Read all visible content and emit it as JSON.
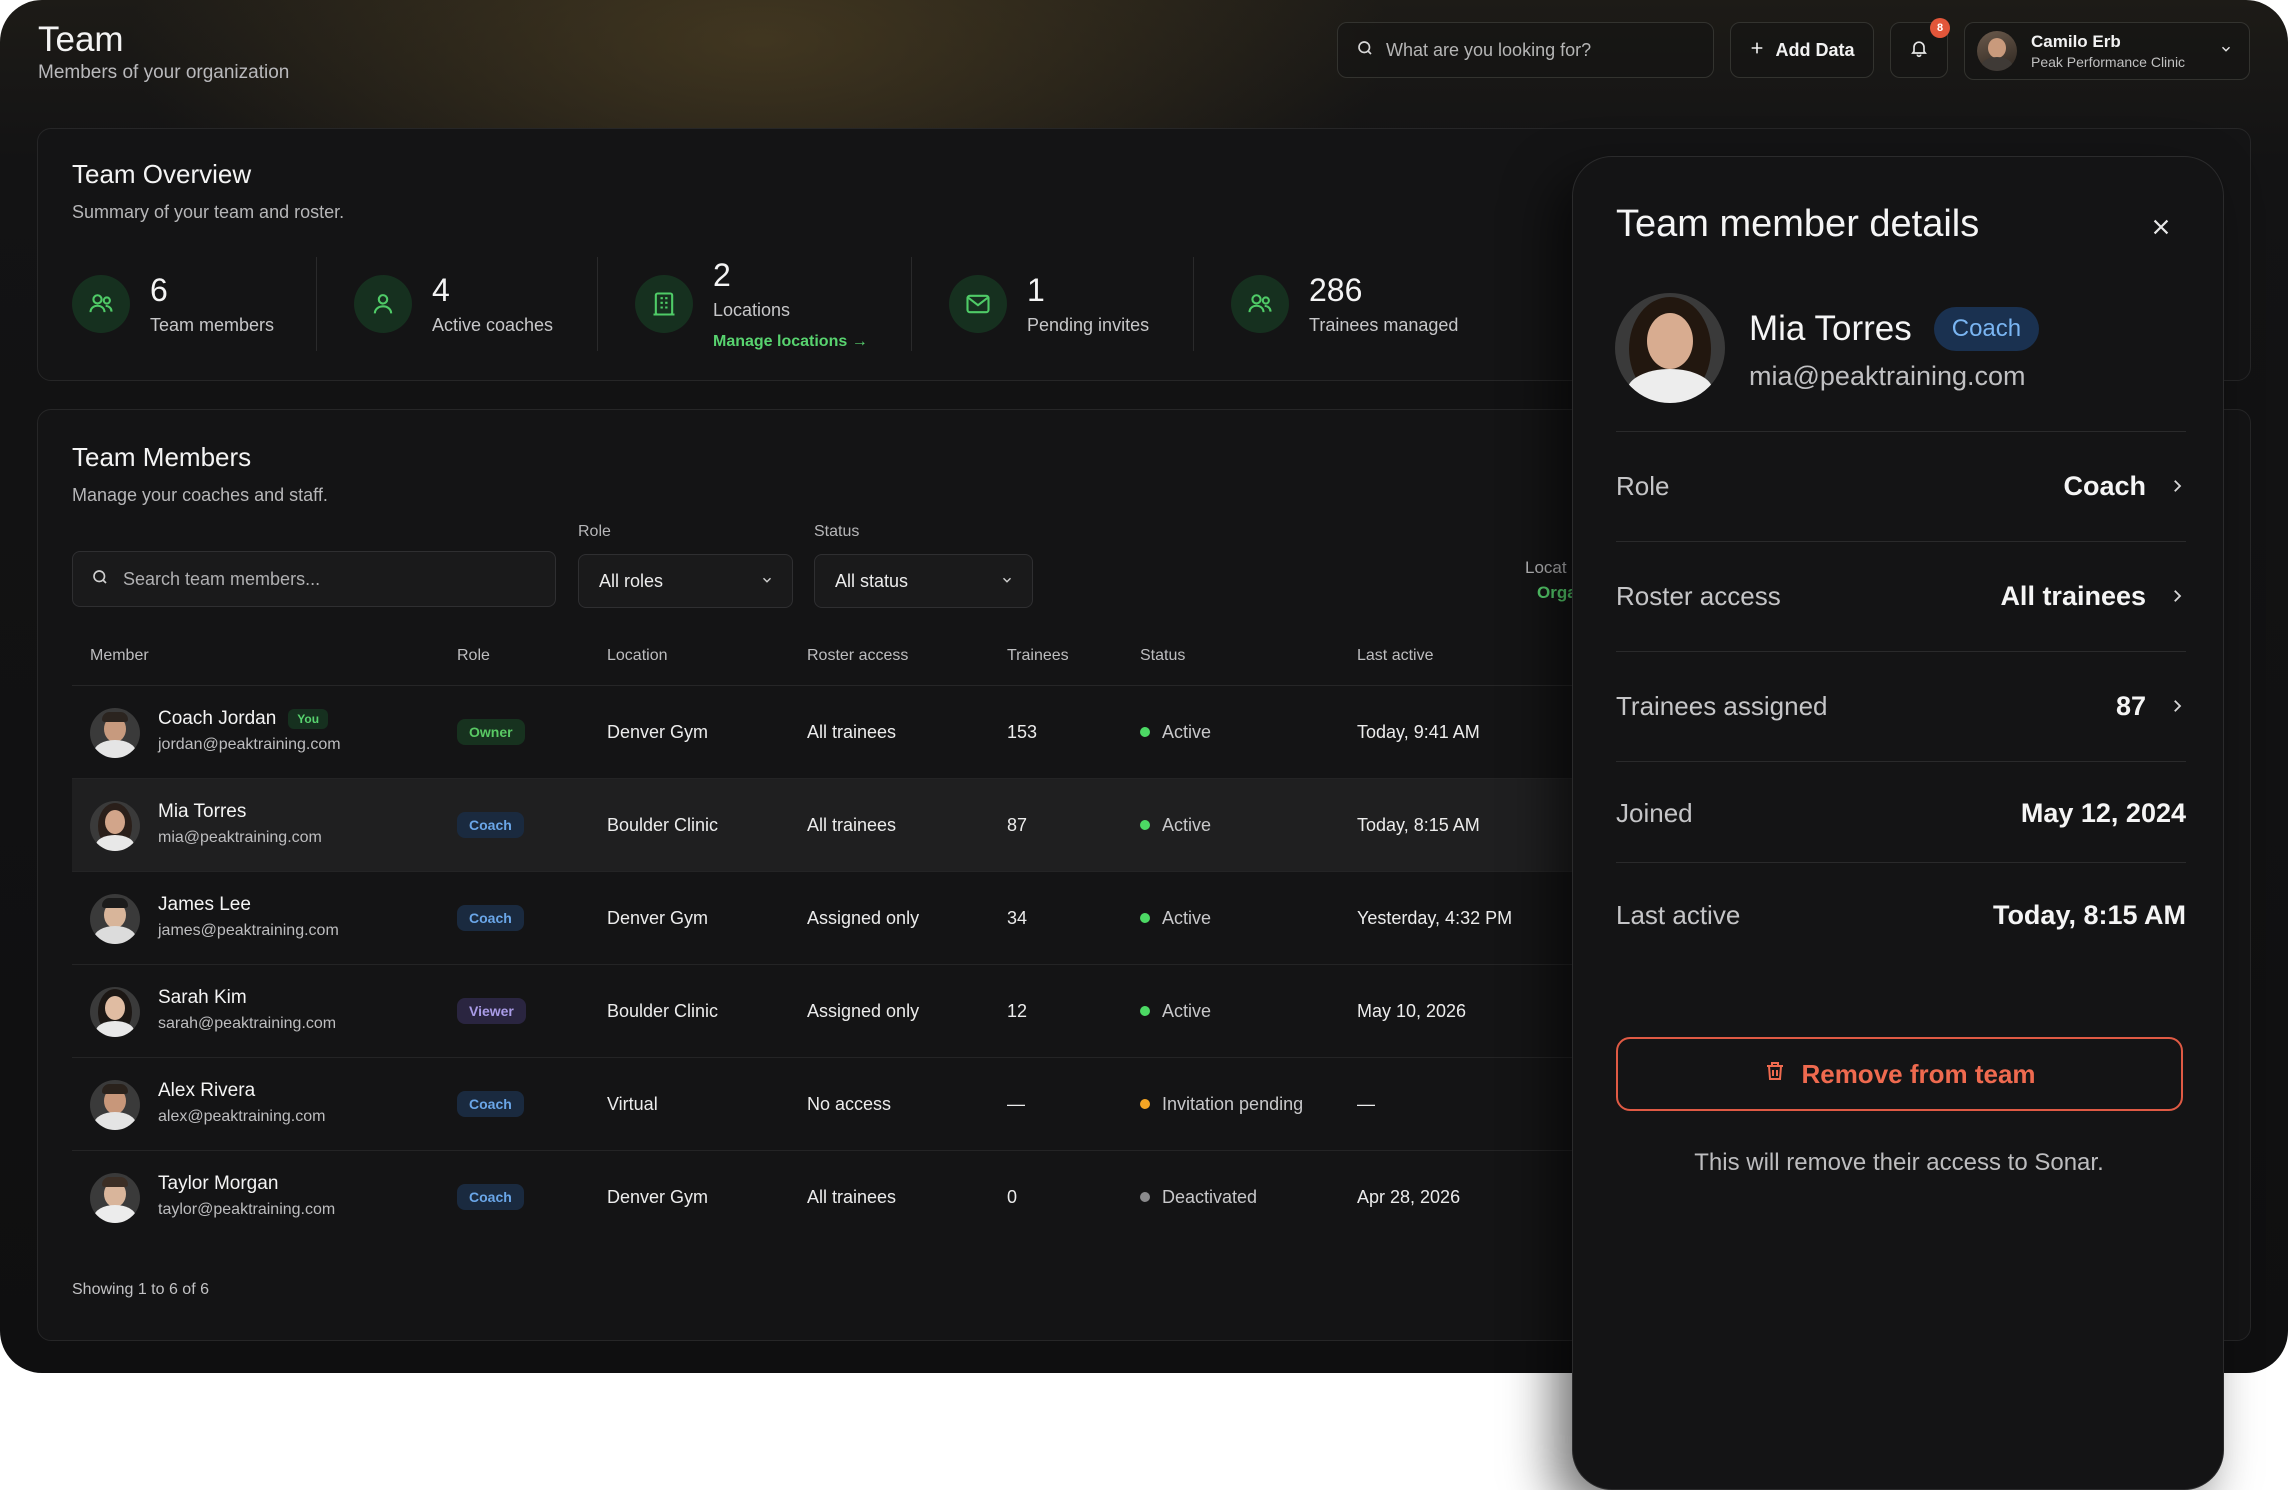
{
  "header": {
    "title": "Team",
    "subtitle": "Members of your organization",
    "search_placeholder": "What are you looking for?",
    "add_label": "Add Data",
    "notification_count": "8",
    "user": {
      "name": "Camilo Erb",
      "org": "Peak Performance Clinic"
    }
  },
  "overview": {
    "title": "Team Overview",
    "subtitle": "Summary of your team and roster.",
    "stats": [
      {
        "value": "6",
        "label": "Team members",
        "icon": "users-icon"
      },
      {
        "value": "4",
        "label": "Active coaches",
        "icon": "user-icon"
      },
      {
        "value": "2",
        "label": "Locations",
        "icon": "building-icon",
        "link": "Manage locations →"
      },
      {
        "value": "1",
        "label": "Pending invites",
        "icon": "mail-icon"
      },
      {
        "value": "286",
        "label": "Trainees managed",
        "icon": "users-icon"
      }
    ]
  },
  "members": {
    "title": "Team Members",
    "subtitle": "Manage your coaches and staff.",
    "search_placeholder": "Search team members...",
    "role_filter": {
      "label": "Role",
      "value": "All roles"
    },
    "status_filter": {
      "label": "Status",
      "value": "All status"
    },
    "location_filter_peek": {
      "label": "Locat",
      "value": "Orga"
    },
    "columns": [
      "Member",
      "Role",
      "Location",
      "Roster access",
      "Trainees",
      "Status",
      "Last active"
    ],
    "rows": [
      {
        "name": "Coach Jordan",
        "you": "You",
        "email": "jordan@peaktraining.com",
        "role": "Owner",
        "location": "Denver Gym",
        "access": "All trainees",
        "trainees": "153",
        "status": "Active",
        "last_active": "Today, 9:41 AM"
      },
      {
        "name": "Mia Torres",
        "you": "",
        "email": "mia@peaktraining.com",
        "role": "Coach",
        "location": "Boulder Clinic",
        "access": "All trainees",
        "trainees": "87",
        "status": "Active",
        "last_active": "Today, 8:15 AM"
      },
      {
        "name": "James Lee",
        "you": "",
        "email": "james@peaktraining.com",
        "role": "Coach",
        "location": "Denver Gym",
        "access": "Assigned only",
        "trainees": "34",
        "status": "Active",
        "last_active": "Yesterday, 4:32 PM"
      },
      {
        "name": "Sarah Kim",
        "you": "",
        "email": "sarah@peaktraining.com",
        "role": "Viewer",
        "location": "Boulder Clinic",
        "access": "Assigned only",
        "trainees": "12",
        "status": "Active",
        "last_active": "May 10, 2026"
      },
      {
        "name": "Alex Rivera",
        "you": "",
        "email": "alex@peaktraining.com",
        "role": "Coach",
        "location": "Virtual",
        "access": "No access",
        "trainees": "—",
        "status": "Invitation pending",
        "last_active": "—"
      },
      {
        "name": "Taylor Morgan",
        "you": "",
        "email": "taylor@peaktraining.com",
        "role": "Coach",
        "location": "Denver Gym",
        "access": "All trainees",
        "trainees": "0",
        "status": "Deactivated",
        "last_active": "Apr 28, 2026"
      }
    ],
    "footer": "Showing 1 to 6 of 6"
  },
  "details": {
    "title": "Team member details",
    "name": "Mia Torres",
    "role_badge": "Coach",
    "email": "mia@peaktraining.com",
    "fields": [
      {
        "label": "Role",
        "value": "Coach",
        "chevron": true
      },
      {
        "label": "Roster access",
        "value": "All trainees",
        "chevron": true
      },
      {
        "label": "Trainees assigned",
        "value": "87",
        "chevron": true
      },
      {
        "label": "Joined",
        "value": "May 12, 2024",
        "chevron": false
      },
      {
        "label": "Last active",
        "value": "Today, 8:15 AM",
        "chevron": false
      }
    ],
    "remove_label": "Remove from team",
    "remove_note": "This will remove their access to Sonar."
  },
  "colors": {
    "accent_green": "#58d36f",
    "status_active": "#4cd964",
    "status_pending": "#f5a524",
    "status_deactivated": "#8a8a8c",
    "danger": "#e05a44",
    "coach_badge": "#6aa6e8",
    "viewer_badge": "#a99be6"
  }
}
